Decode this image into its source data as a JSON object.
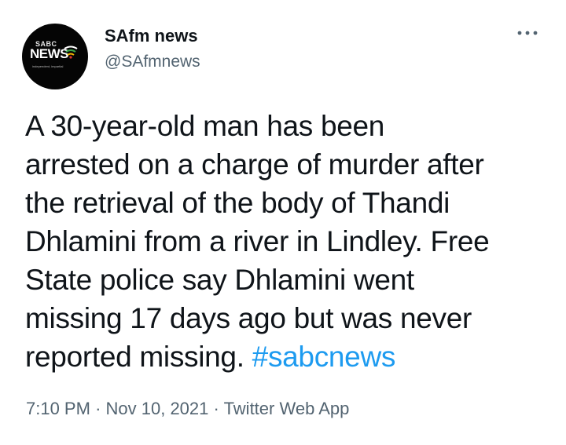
{
  "author": {
    "name": "SAfm news",
    "handle": "@SAfmnews",
    "avatar": {
      "logo_small": "SABC",
      "logo_large": "NEWS",
      "logo_tagline": "independent, impartial"
    }
  },
  "menu": {
    "icon": "more-horizontal-icon"
  },
  "tweet": {
    "lines": [
      "A 30-year-old man has been",
      "arrested on a charge of murder after",
      "the retrieval of the body of Thandi",
      "Dhlamini from a river in Lindley. Free",
      "State police say Dhlamini went",
      "missing 17 days ago but was never",
      "reported missing. "
    ],
    "hashtag": "#sabcnews"
  },
  "meta": {
    "time": "7:10 PM",
    "separator": "·",
    "date": "Nov 10, 2021",
    "source": "Twitter Web App"
  },
  "colors": {
    "text": "#0f1419",
    "secondary": "#536471",
    "link": "#1d9bf0",
    "avatar_bg": "#050505"
  }
}
